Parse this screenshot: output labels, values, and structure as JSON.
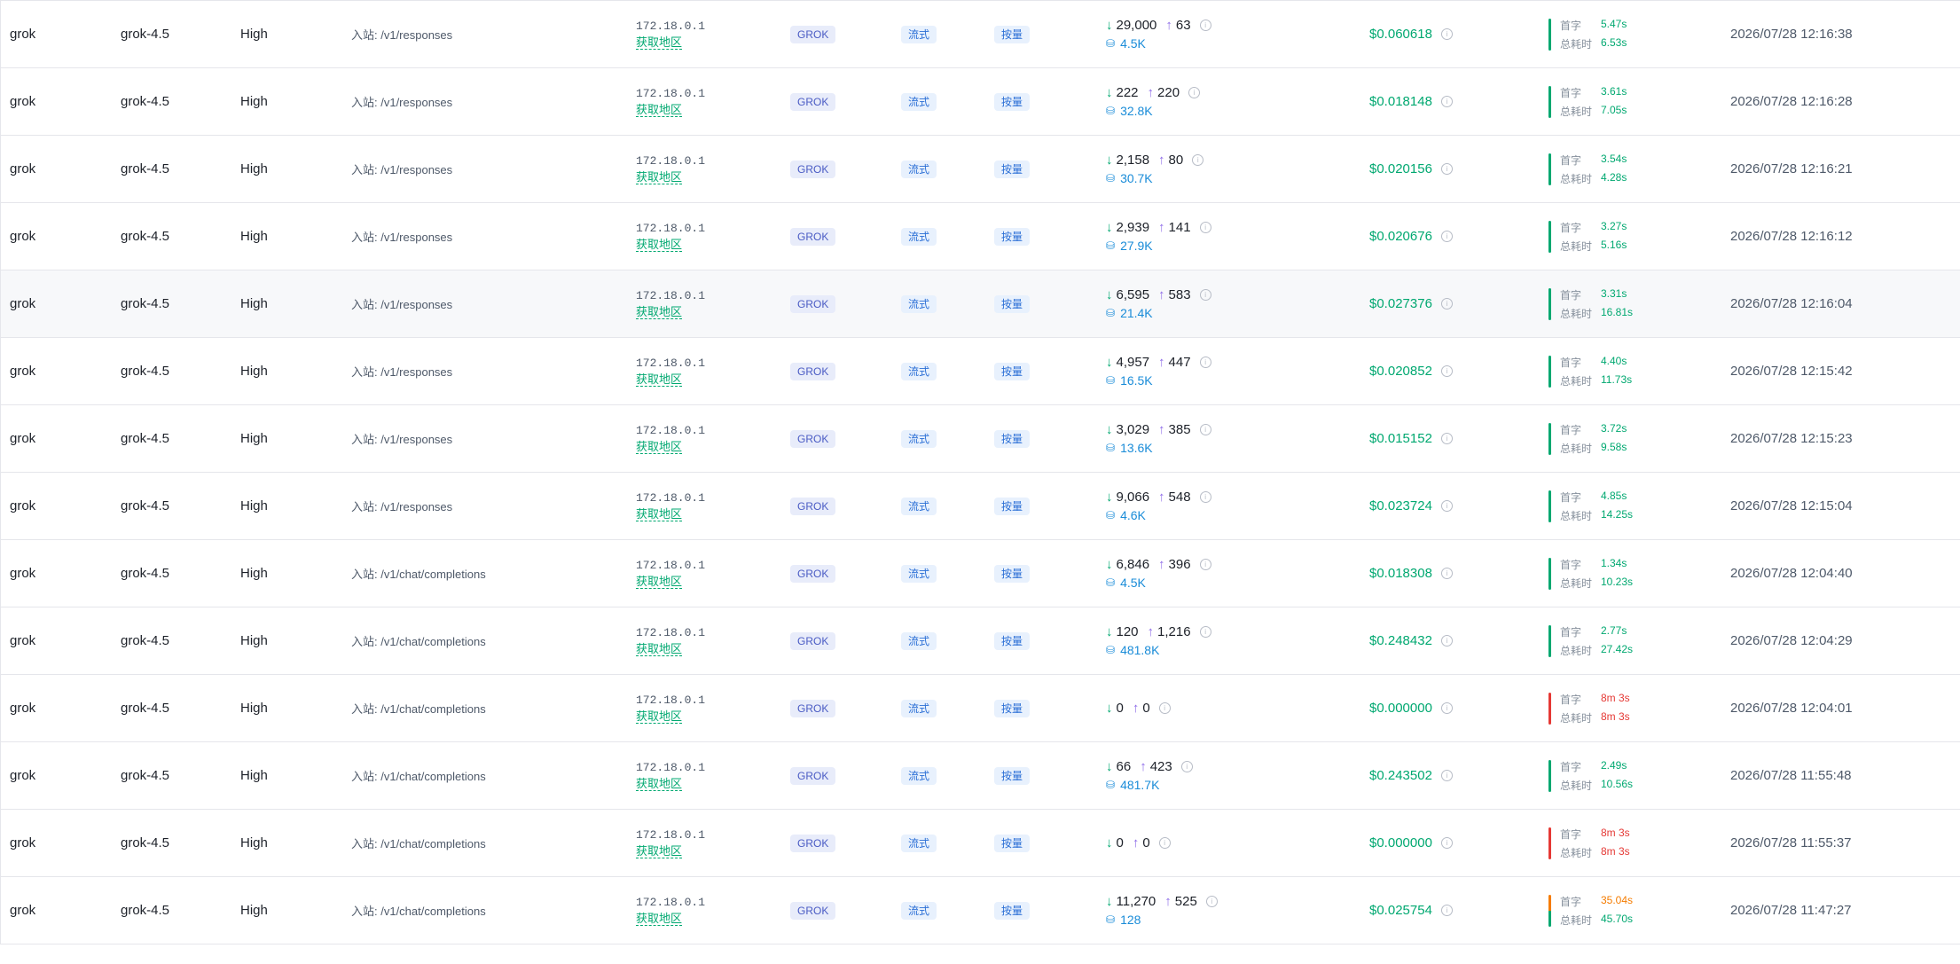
{
  "labels": {
    "first_token": "首字",
    "total_time": "总耗时",
    "region_link": "获取地区"
  },
  "colors": {
    "ok": "#00a870",
    "error": "#e53935",
    "warn": "#f57c00"
  },
  "rows": [
    {
      "model": "grok",
      "name": "grok-4.5",
      "effort": "High",
      "endpoint": "入站: /v1/responses",
      "ip": "172.18.0.1",
      "provider": "GROK",
      "stream": "流式",
      "billing": "按量",
      "tokens_in": "29,000",
      "tokens_out": "63",
      "cache": "4.5K",
      "cost": "$0.060618",
      "first": "5.47s",
      "total": "6.53s",
      "status": "ok",
      "time": "2026/07/28 12:16:38"
    },
    {
      "model": "grok",
      "name": "grok-4.5",
      "effort": "High",
      "endpoint": "入站: /v1/responses",
      "ip": "172.18.0.1",
      "provider": "GROK",
      "stream": "流式",
      "billing": "按量",
      "tokens_in": "222",
      "tokens_out": "220",
      "cache": "32.8K",
      "cost": "$0.018148",
      "first": "3.61s",
      "total": "7.05s",
      "status": "ok",
      "time": "2026/07/28 12:16:28"
    },
    {
      "model": "grok",
      "name": "grok-4.5",
      "effort": "High",
      "endpoint": "入站: /v1/responses",
      "ip": "172.18.0.1",
      "provider": "GROK",
      "stream": "流式",
      "billing": "按量",
      "tokens_in": "2,158",
      "tokens_out": "80",
      "cache": "30.7K",
      "cost": "$0.020156",
      "first": "3.54s",
      "total": "4.28s",
      "status": "ok",
      "time": "2026/07/28 12:16:21"
    },
    {
      "model": "grok",
      "name": "grok-4.5",
      "effort": "High",
      "endpoint": "入站: /v1/responses",
      "ip": "172.18.0.1",
      "provider": "GROK",
      "stream": "流式",
      "billing": "按量",
      "tokens_in": "2,939",
      "tokens_out": "141",
      "cache": "27.9K",
      "cost": "$0.020676",
      "first": "3.27s",
      "total": "5.16s",
      "status": "ok",
      "time": "2026/07/28 12:16:12"
    },
    {
      "model": "grok",
      "name": "grok-4.5",
      "effort": "High",
      "endpoint": "入站: /v1/responses",
      "ip": "172.18.0.1",
      "provider": "GROK",
      "stream": "流式",
      "billing": "按量",
      "tokens_in": "6,595",
      "tokens_out": "583",
      "cache": "21.4K",
      "cost": "$0.027376",
      "first": "3.31s",
      "total": "16.81s",
      "status": "ok",
      "time": "2026/07/28 12:16:04",
      "highlight": true
    },
    {
      "model": "grok",
      "name": "grok-4.5",
      "effort": "High",
      "endpoint": "入站: /v1/responses",
      "ip": "172.18.0.1",
      "provider": "GROK",
      "stream": "流式",
      "billing": "按量",
      "tokens_in": "4,957",
      "tokens_out": "447",
      "cache": "16.5K",
      "cost": "$0.020852",
      "first": "4.40s",
      "total": "11.73s",
      "status": "ok",
      "time": "2026/07/28 12:15:42"
    },
    {
      "model": "grok",
      "name": "grok-4.5",
      "effort": "High",
      "endpoint": "入站: /v1/responses",
      "ip": "172.18.0.1",
      "provider": "GROK",
      "stream": "流式",
      "billing": "按量",
      "tokens_in": "3,029",
      "tokens_out": "385",
      "cache": "13.6K",
      "cost": "$0.015152",
      "first": "3.72s",
      "total": "9.58s",
      "status": "ok",
      "time": "2026/07/28 12:15:23"
    },
    {
      "model": "grok",
      "name": "grok-4.5",
      "effort": "High",
      "endpoint": "入站: /v1/responses",
      "ip": "172.18.0.1",
      "provider": "GROK",
      "stream": "流式",
      "billing": "按量",
      "tokens_in": "9,066",
      "tokens_out": "548",
      "cache": "4.6K",
      "cost": "$0.023724",
      "first": "4.85s",
      "total": "14.25s",
      "status": "ok",
      "time": "2026/07/28 12:15:04"
    },
    {
      "model": "grok",
      "name": "grok-4.5",
      "effort": "High",
      "endpoint": "入站: /v1/chat/completions",
      "ip": "172.18.0.1",
      "provider": "GROK",
      "stream": "流式",
      "billing": "按量",
      "tokens_in": "6,846",
      "tokens_out": "396",
      "cache": "4.5K",
      "cost": "$0.018308",
      "first": "1.34s",
      "total": "10.23s",
      "status": "ok",
      "time": "2026/07/28 12:04:40"
    },
    {
      "model": "grok",
      "name": "grok-4.5",
      "effort": "High",
      "endpoint": "入站: /v1/chat/completions",
      "ip": "172.18.0.1",
      "provider": "GROK",
      "stream": "流式",
      "billing": "按量",
      "tokens_in": "120",
      "tokens_out": "1,216",
      "cache": "481.8K",
      "cost": "$0.248432",
      "first": "2.77s",
      "total": "27.42s",
      "status": "ok",
      "time": "2026/07/28 12:04:29"
    },
    {
      "model": "grok",
      "name": "grok-4.5",
      "effort": "High",
      "endpoint": "入站: /v1/chat/completions",
      "ip": "172.18.0.1",
      "provider": "GROK",
      "stream": "流式",
      "billing": "按量",
      "tokens_in": "0",
      "tokens_out": "0",
      "cache": "",
      "cost": "$0.000000",
      "first": "8m 3s",
      "total": "8m 3s",
      "status": "err",
      "time": "2026/07/28 12:04:01"
    },
    {
      "model": "grok",
      "name": "grok-4.5",
      "effort": "High",
      "endpoint": "入站: /v1/chat/completions",
      "ip": "172.18.0.1",
      "provider": "GROK",
      "stream": "流式",
      "billing": "按量",
      "tokens_in": "66",
      "tokens_out": "423",
      "cache": "481.7K",
      "cost": "$0.243502",
      "first": "2.49s",
      "total": "10.56s",
      "status": "ok",
      "time": "2026/07/28 11:55:48"
    },
    {
      "model": "grok",
      "name": "grok-4.5",
      "effort": "High",
      "endpoint": "入站: /v1/chat/completions",
      "ip": "172.18.0.1",
      "provider": "GROK",
      "stream": "流式",
      "billing": "按量",
      "tokens_in": "0",
      "tokens_out": "0",
      "cache": "",
      "cost": "$0.000000",
      "first": "8m 3s",
      "total": "8m 3s",
      "status": "err",
      "time": "2026/07/28 11:55:37"
    },
    {
      "model": "grok",
      "name": "grok-4.5",
      "effort": "High",
      "endpoint": "入站: /v1/chat/completions",
      "ip": "172.18.0.1",
      "provider": "GROK",
      "stream": "流式",
      "billing": "按量",
      "tokens_in": "11,270",
      "tokens_out": "525",
      "cache": "128",
      "cost": "$0.025754",
      "first": "35.04s",
      "total": "45.70s",
      "status": "warn",
      "time": "2026/07/28 11:47:27"
    }
  ]
}
